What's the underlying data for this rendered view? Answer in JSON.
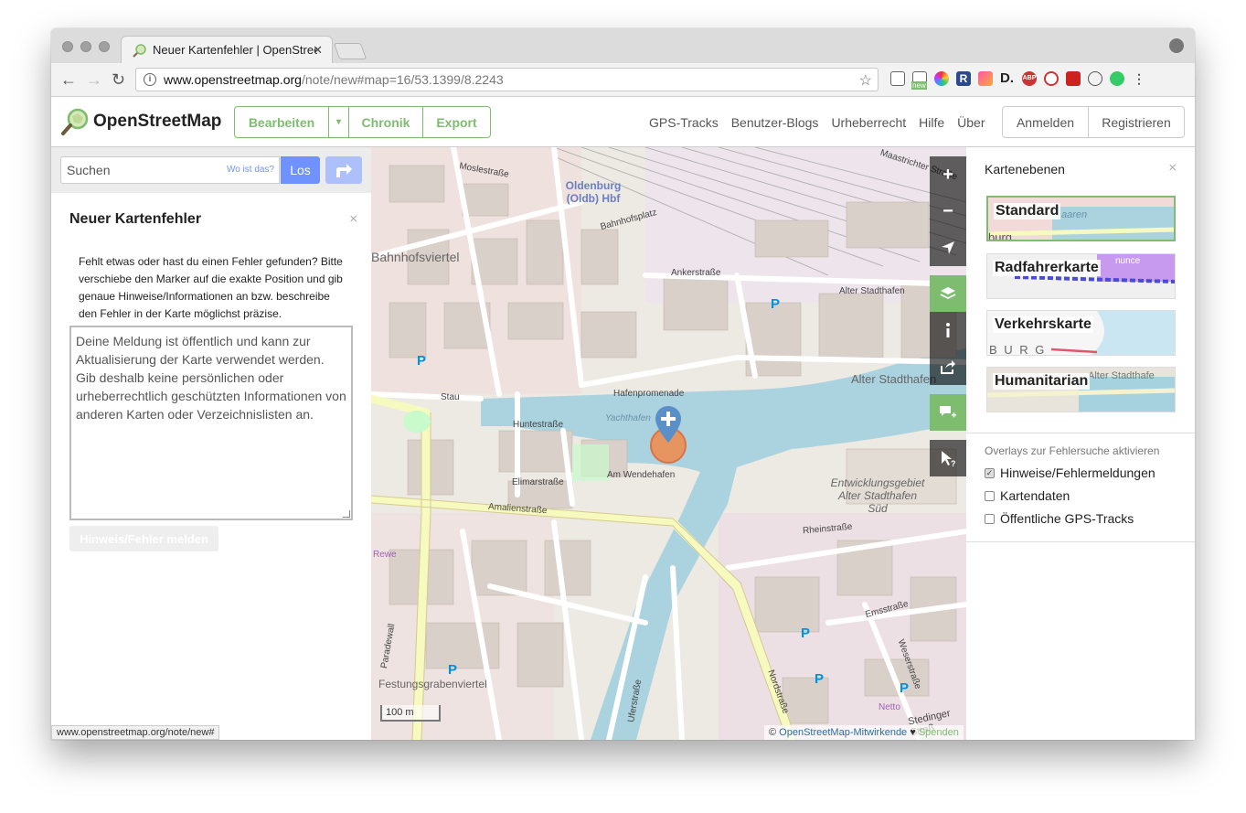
{
  "browser": {
    "tab_title": "Neuer Kartenfehler | OpenStreetMap",
    "tab_close": "✕",
    "url_host": "www.openstreetmap.org",
    "url_path": "/note/new#map=16/53.1399/8.2243",
    "ext_badge": "new",
    "status_url": "www.openstreetmap.org/note/new#"
  },
  "header": {
    "logo_text": "OpenStreetMap",
    "edit_label": "Bearbeiten",
    "history_label": "Chronik",
    "export_label": "Export",
    "links": [
      "GPS-Tracks",
      "Benutzer-Blogs",
      "Urheberrecht",
      "Hilfe",
      "Über"
    ],
    "login_label": "Anmelden",
    "signup_label": "Registrieren"
  },
  "search": {
    "placeholder": "Suchen",
    "where_label": "Wo ist das?",
    "go_label": "Los"
  },
  "note": {
    "title": "Neuer Kartenfehler",
    "close": "×",
    "intro": "Fehlt etwas oder hast du einen Fehler gefunden? Bitte verschiebe den Marker auf die exakte Position und gib genaue Hinweise/Informationen an bzw. beschreibe den Fehler in der Karte möglichst präzise.",
    "placeholder": "Deine Meldung ist öffentlich und kann zur Aktualisierung der Karte verwendet werden. Gib deshalb keine persönlichen oder urheberrechtlich geschützten Informationen von anderen Karten oder Verzeichnislisten an.",
    "submit_label": "Hinweis/Fehler melden"
  },
  "map": {
    "labels": {
      "station": "Oldenburg (Oldb) Hbf",
      "district1": "Bahnhofsviertel",
      "district2": "Festungsgrabenviertel",
      "dev_area1": "Entwicklungsgebiet",
      "dev_area2": "Alter Stadthafen",
      "dev_area3": "Süd",
      "alter_stadthafen": "Alter Stadthafen",
      "hafenpromenade": "Hafenpromenade",
      "stau": "Stau",
      "huntestrasse": "Huntestraße",
      "amalienstrasse": "Amalienstraße",
      "elimarstrasse": "Elimarstraße",
      "am_wendehafen": "Am Wendehafen",
      "rheinstrasse": "Rheinstraße",
      "emsstrasse": "Emsstraße",
      "weserstrasse": "Weserstraße",
      "nordstrasse": "Nordstraße",
      "uferstrasse": "Uferstraße",
      "ankerstrasse": "Ankerstraße",
      "alter_stadthafen_street": "Alter Stadthafen",
      "bahnhofsplatz": "Bahnhofsplatz",
      "moslestrasse": "Moslestraße",
      "maastrichter": "Maastrichter Straße",
      "yachthafen": "Yachthafen",
      "stedinger": "Stedinger Straß",
      "paradewall": "Paradewall",
      "rewe": "Rewe",
      "netto": "Netto"
    },
    "scale_label": "100 m",
    "attribution_prefix": "©",
    "attribution_link": "OpenStreetMap-Mitwirkende",
    "attribution_heart": "♥",
    "attribution_donate": "Spenden",
    "controls": [
      "zoom-in",
      "zoom-out",
      "locate",
      "layers",
      "info",
      "share",
      "add-note",
      "query"
    ]
  },
  "layers_panel": {
    "title": "Kartenebenen",
    "close": "×",
    "layers": [
      {
        "name": "Standard",
        "selected": true
      },
      {
        "name": "Radfahrerkarte",
        "selected": false
      },
      {
        "name": "Verkehrskarte",
        "selected": false
      },
      {
        "name": "Humanitarian",
        "selected": false
      }
    ],
    "thumb_texts": {
      "standard": "aaren",
      "standard2": "burg",
      "cycle": "nunce",
      "transport": "B U R G",
      "humanitarian": "Alter Stadthafe"
    },
    "overlays_title": "Overlays zur Fehlersuche aktivieren",
    "overlays": [
      {
        "label": "Hinweise/Fehlermeldungen",
        "checked": true
      },
      {
        "label": "Kartendaten",
        "checked": false
      },
      {
        "label": "Öffentliche GPS-Tracks",
        "checked": false
      }
    ],
    "check_mark": "✓"
  },
  "colors": {
    "osm_green": "#7ebc6f",
    "search_blue": "#7092ff",
    "water": "#aad3df",
    "road_yellow": "#f7fabf",
    "marker_blue": "#0092da",
    "marker_orange": "#f18b4a"
  }
}
